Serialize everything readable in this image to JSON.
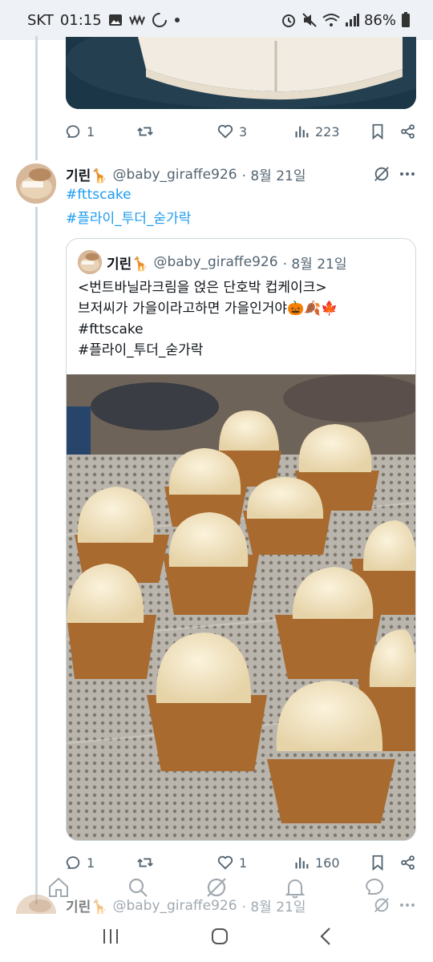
{
  "status_bar": {
    "carrier": "SKT",
    "time": "01:15",
    "battery": "86%",
    "icons": [
      "gallery-icon",
      "wave-icon",
      "loading-icon",
      "dot-icon",
      "alarm-icon",
      "mute-icon",
      "wifi-icon",
      "signal-icon",
      "battery-icon"
    ]
  },
  "tweet1_actions": {
    "replies": "1",
    "retweets": "",
    "likes": "3",
    "views": "223"
  },
  "tweet2": {
    "name": "기린🦒",
    "handle": "@baby_giraffe926",
    "date": "· 8월 21일",
    "hashtags": [
      "#fttscake",
      "#플라이_투더_숟가락"
    ],
    "quote": {
      "name": "기린🦒",
      "handle": "@baby_giraffe926",
      "date": "· 8월 21일",
      "lines": [
        "<번트바닐라크림을 얹은 단호박 컵케이크>",
        "브저씨가 가을이라고하면 가을인거야🎃🍂🍁",
        "#fttscake",
        "#플라이_투더_숟가락"
      ]
    },
    "actions": {
      "replies": "1",
      "retweets": "",
      "likes": "1",
      "views": "160"
    }
  },
  "tweet3": {
    "name": "기린🦒",
    "handle": "@baby_giraffe926",
    "date": "· 8월 21일"
  },
  "bottom_nav": [
    "home-icon",
    "search-icon",
    "grok-icon",
    "notifications-icon",
    "messages-icon"
  ],
  "colors": {
    "link": "#1d9bf0",
    "muted": "#536471",
    "border": "#cfd9de"
  }
}
